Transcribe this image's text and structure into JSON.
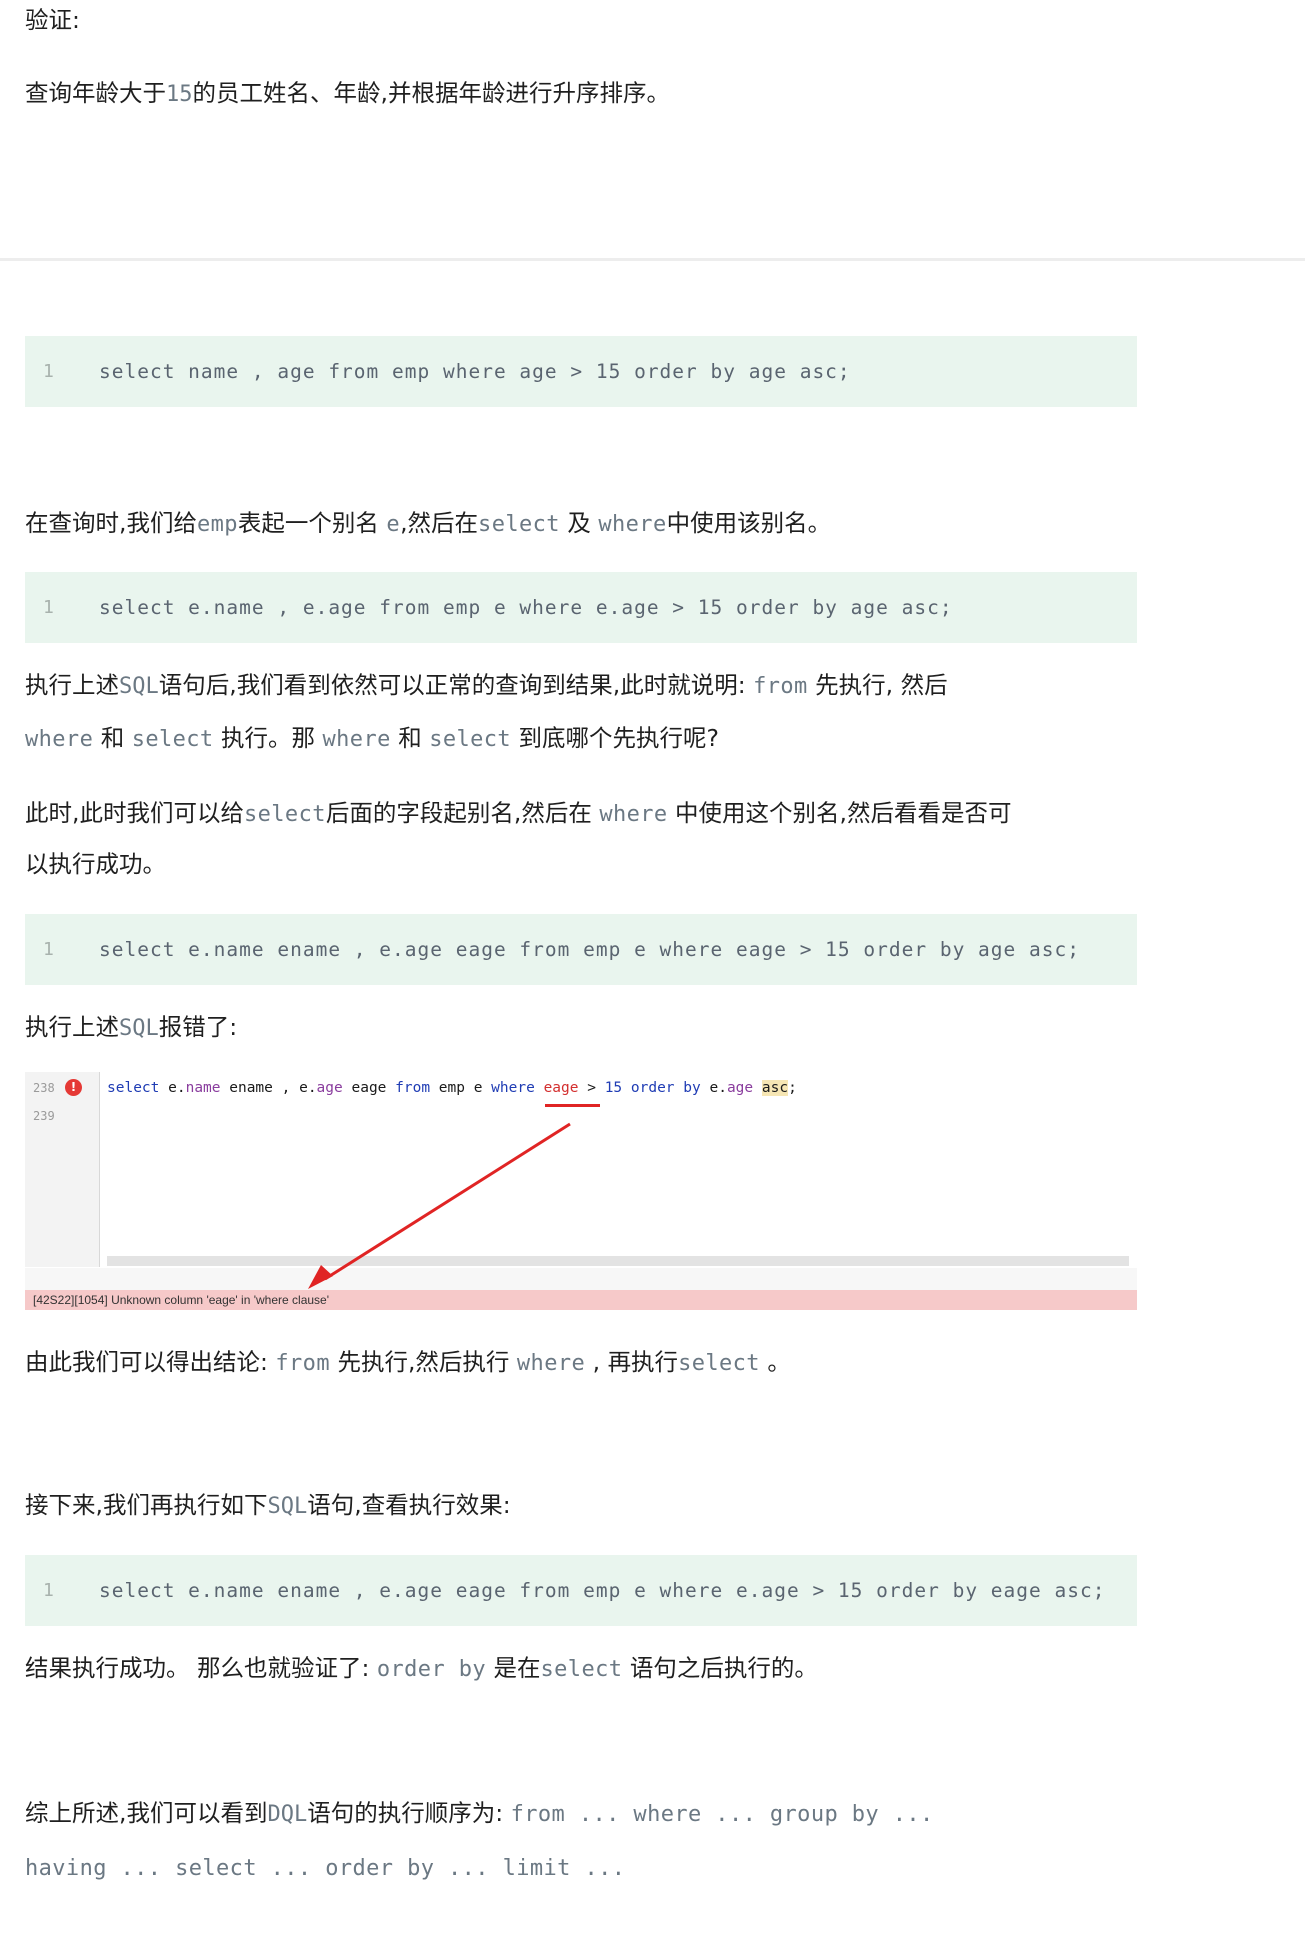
{
  "heading_verify": "验证:",
  "p_query_desc": {
    "a": "查询年龄大于",
    "b": "15",
    "c": "的员工姓名、年龄,并根据年龄进行升序排序。"
  },
  "code1": {
    "line": "1",
    "text": "select name , age from emp where age > 15 order by age asc;"
  },
  "p_alias": {
    "a": "在查询时,我们给",
    "b": "emp",
    "c": "表起一个别名 ",
    "d": "e",
    "e": ",然后在",
    "f": "select",
    "g": " 及 ",
    "h": "where",
    "i": "中使用该别名。"
  },
  "code2": {
    "line": "1",
    "text": "select e.name , e.age from emp e where e.age > 15 order by age asc;"
  },
  "p_exec1": {
    "a": "执行上述",
    "b": "SQL",
    "c": "语句后,我们看到依然可以正常的查询到结果,此时就说明: ",
    "d": "from",
    "e": " 先执行, 然后"
  },
  "p_exec2": {
    "a": "where",
    "b": " 和 ",
    "c": "select",
    "d": " 执行。那 ",
    "e": "where",
    "f": " 和 ",
    "g": "select",
    "h": " 到底哪个先执行呢?"
  },
  "p_field1": {
    "a": "此时,此时我们可以给",
    "b": "select",
    "c": "后面的字段起别名,然后在 ",
    "d": "where",
    "e": " 中使用这个别名,然后看看是否可"
  },
  "p_field2": "以执行成功。",
  "code3": {
    "line": "1",
    "text": "select e.name ename , e.age eage from emp e where eage > 15 order by age asc;"
  },
  "p_error": {
    "a": "执行上述",
    "b": "SQL",
    "c": "报错了:"
  },
  "ide": {
    "line1": "238",
    "line2": "239",
    "err_icon": "!",
    "tokens": {
      "t1": "select",
      "t2": " e.",
      "t3": "name",
      "t4": " ename , e.",
      "t5": "age",
      "t6": " eage ",
      "t7": "from",
      "t8": " emp e ",
      "t9": "where",
      "t10": " ",
      "t11": "eage",
      "t12": " > ",
      "t13": "15",
      "t14": " ",
      "t15": "order by",
      "t16": " e.",
      "t17": "age",
      "t18": " ",
      "t19": "asc",
      "t20": ";"
    },
    "error_message": "[42S22][1054] Unknown column 'eage' in 'where clause'"
  },
  "p_conclusion": {
    "a": "由此我们可以得出结论: ",
    "b": "from",
    "c": " 先执行,然后执行 ",
    "d": "where",
    "e": " , ",
    "f": "再执行",
    "g": "select",
    "h": " 。"
  },
  "p_next": {
    "a": "接下来,我们再执行如下",
    "b": "SQL",
    "c": "语句,查看执行效果:"
  },
  "code4": {
    "line": "1",
    "text": "select e.name ename , e.age eage from emp e where e.age > 15 order by eage asc;"
  },
  "p_success": {
    "a": "结果执行成功。 那么也就验证了: ",
    "b": "order by",
    "c": " 是在",
    "d": "select",
    "e": " 语句之后执行的。"
  },
  "p_summary1": {
    "a": "综上所述,我们可以看到",
    "b": "DQL",
    "c": "语句的执行顺序为: ",
    "d": "from ... where ... group by ..."
  },
  "p_summary2": "having ... select ... order by ... limit ...",
  "colors": {
    "code_bg": "#e9f5ee",
    "error_bar": "#f6c9c9",
    "arrow": "#e02424",
    "keyword": "#1f3cb4"
  }
}
